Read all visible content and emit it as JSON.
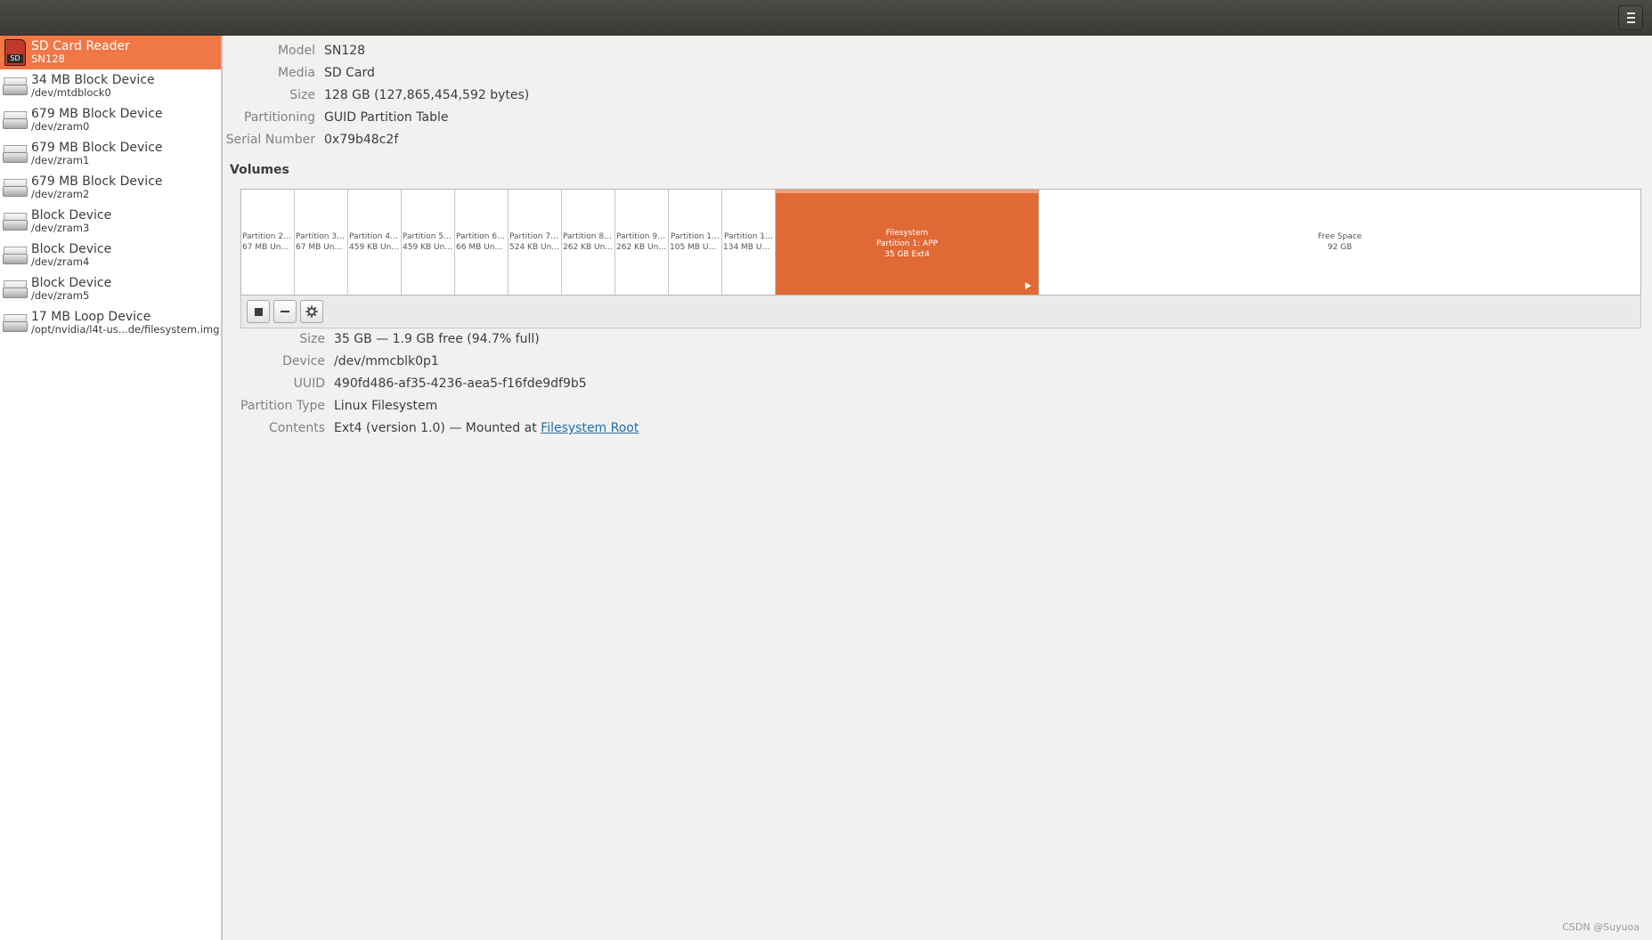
{
  "header": {
    "menu_icon": "hamburger-menu-icon"
  },
  "sidebar": {
    "items": [
      {
        "title": "SD Card Reader",
        "sub": "SN128",
        "icon": "sd-card-icon",
        "icon_label": "SD",
        "selected": true
      },
      {
        "title": "34 MB Block Device",
        "sub": "/dev/mtdblock0",
        "icon": "disk-icon"
      },
      {
        "title": "679 MB Block Device",
        "sub": "/dev/zram0",
        "icon": "disk-icon"
      },
      {
        "title": "679 MB Block Device",
        "sub": "/dev/zram1",
        "icon": "disk-icon"
      },
      {
        "title": "679 MB Block Device",
        "sub": "/dev/zram2",
        "icon": "disk-icon"
      },
      {
        "title": "Block Device",
        "sub": "/dev/zram3",
        "icon": "disk-icon"
      },
      {
        "title": "Block Device",
        "sub": "/dev/zram4",
        "icon": "disk-icon"
      },
      {
        "title": "Block Device",
        "sub": "/dev/zram5",
        "icon": "disk-icon"
      },
      {
        "title": "17 MB Loop Device",
        "sub": "/opt/nvidia/l4t-us...de/filesystem.img",
        "icon": "disk-icon"
      }
    ]
  },
  "drive": {
    "model_label": "Model",
    "model": "SN128",
    "media_label": "Media",
    "media": "SD Card",
    "size_label": "Size",
    "size": "128 GB (127,865,454,592 bytes)",
    "partitioning_label": "Partitioning",
    "partitioning": "GUID Partition Table",
    "serial_label": "Serial Number",
    "serial": "0x79b48c2f"
  },
  "volumes": {
    "heading": "Volumes",
    "partitions": [
      {
        "name": "Partition 2: …",
        "info": "67 MB Unkn…"
      },
      {
        "name": "Partition 3: …",
        "info": "67 MB Unkn…"
      },
      {
        "name": "Partition 4: …",
        "info": "459 KB Unk…"
      },
      {
        "name": "Partition 5: …",
        "info": "459 KB Unk…"
      },
      {
        "name": "Partition 6: …",
        "info": "66 MB Unkn…"
      },
      {
        "name": "Partition 7: …",
        "info": "524 KB Unk…"
      },
      {
        "name": "Partition 8: …",
        "info": "262 KB Unk…"
      },
      {
        "name": "Partition 9: …",
        "info": "262 KB Unk…"
      },
      {
        "name": "Partition 1…",
        "info": "105 MB Unk…"
      },
      {
        "name": "Partition 1…",
        "info": "134 MB Unk…"
      }
    ],
    "selected": {
      "line1": "Filesystem",
      "line2": "Partition 1: APP",
      "line3": "35 GB Ext4"
    },
    "free": {
      "line1": "Free Space",
      "line2": "92 GB"
    },
    "colors": {
      "selected": "#e06a36",
      "accent": "#f07746"
    }
  },
  "toolbar": {
    "stop_icon": "stop-icon",
    "remove_icon": "minus-icon",
    "settings_icon": "gear-icon"
  },
  "volume_details": {
    "size_label": "Size",
    "size": "35 GB — 1.9 GB free (94.7% full)",
    "device_label": "Device",
    "device": "/dev/mmcblk0p1",
    "uuid_label": "UUID",
    "uuid": "490fd486-af35-4236-aea5-f16fde9df9b5",
    "ptype_label": "Partition Type",
    "ptype": "Linux Filesystem",
    "contents_label": "Contents",
    "contents_prefix": "Ext4 (version 1.0) — Mounted at ",
    "contents_link": "Filesystem Root"
  },
  "watermark": "CSDN @Suyuoa"
}
